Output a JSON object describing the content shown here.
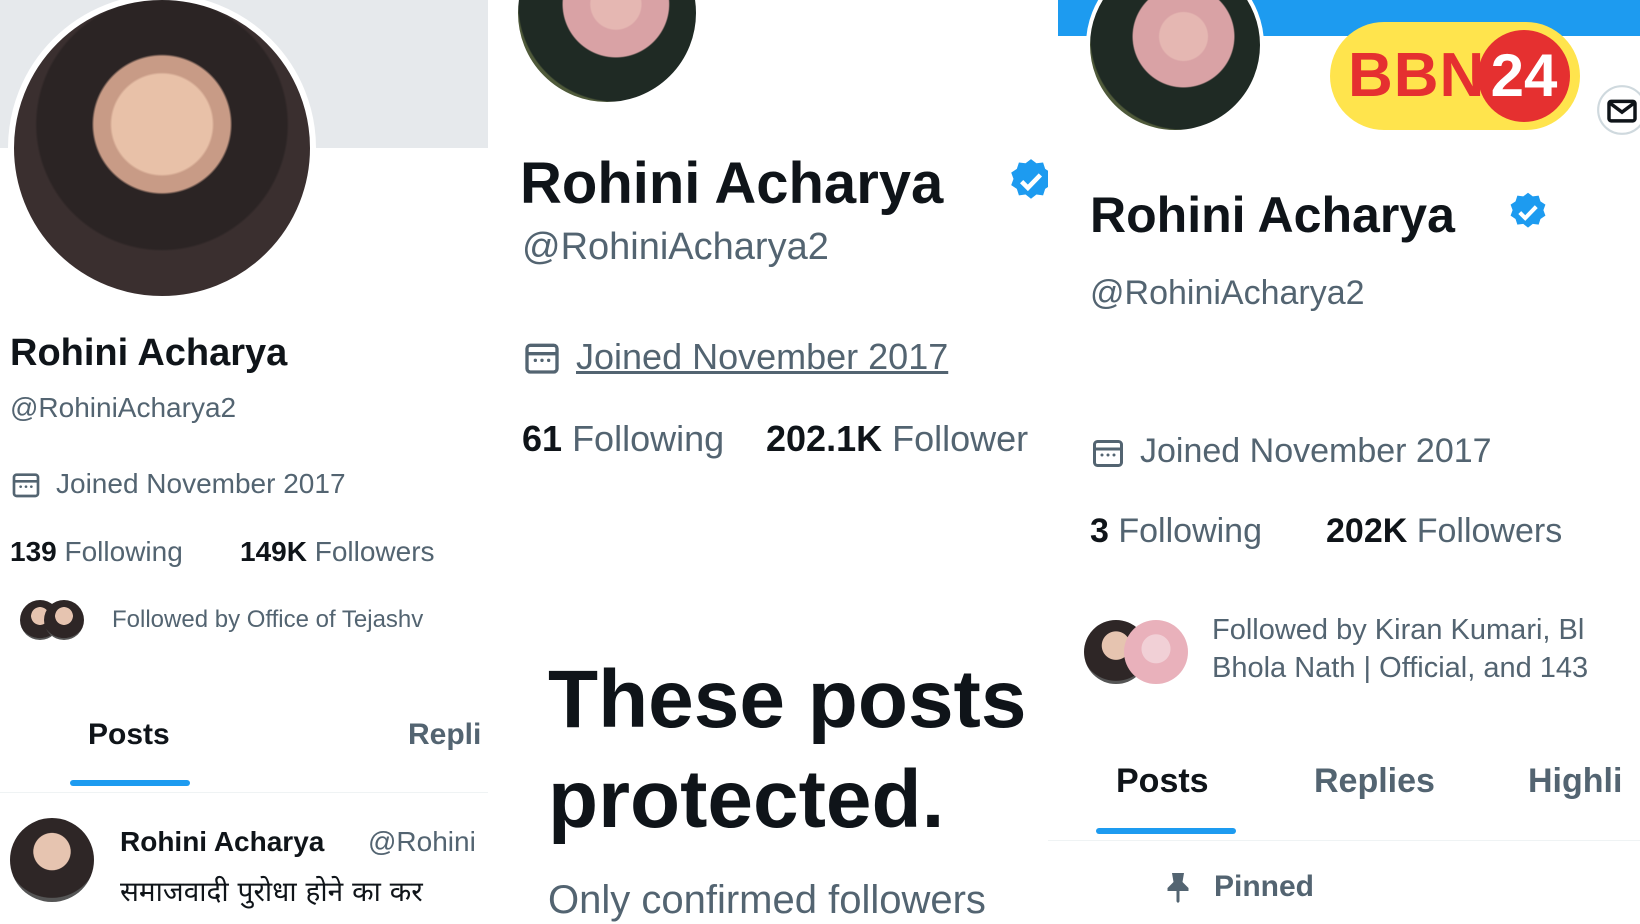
{
  "panel_left": {
    "name": "Rohini Acharya",
    "handle": "@RohiniAcharya2",
    "joined": "Joined November 2017",
    "following_count": "139",
    "following_label": "Following",
    "followers_count": "149K",
    "followers_label": "Followers",
    "followed_by": "Followed by Office of Tejashv",
    "tabs": [
      "Posts",
      "Repli"
    ],
    "post_author": "Rohini Acharya",
    "post_handle": "@Rohini",
    "post_text": "समाजवादी पुरोधा होने का कर"
  },
  "panel_middle": {
    "name": "Rohini Acharya",
    "handle": "@RohiniAcharya2",
    "joined": "Joined November 2017",
    "following_count": "61",
    "following_label": "Following",
    "followers_count": "202.1K",
    "followers_label": "Follower",
    "protected_title_line1": "These posts",
    "protected_title_line2": "protected.",
    "protected_sub": "Only confirmed followers"
  },
  "panel_right": {
    "name": "Rohini Acharya",
    "handle": "@RohiniAcharya2",
    "joined": "Joined November 2017",
    "following_count": "3",
    "following_label": "Following",
    "followers_count": "202K",
    "followers_label": "Followers",
    "followed_by_line1": "Followed by Kiran Kumari, Bl",
    "followed_by_line2": "Bhola Nath | Official, and 143",
    "tabs": [
      "Posts",
      "Replies",
      "Highli"
    ],
    "pinned": "Pinned"
  },
  "logo": {
    "text": "BBN",
    "number": "24"
  },
  "colors": {
    "accent": "#1d9bf0",
    "logo_bg": "#ffe44d",
    "logo_red": "#e53030"
  }
}
